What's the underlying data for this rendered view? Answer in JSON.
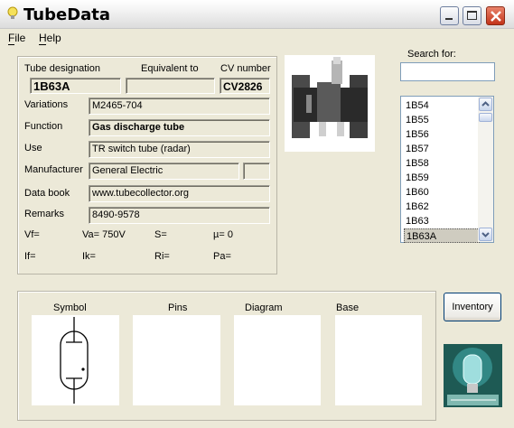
{
  "window": {
    "title": "TubeData"
  },
  "menu": {
    "file": "File",
    "help": "Help"
  },
  "header": {
    "tube_designation_label": "Tube designation",
    "tube_designation_value": "1B63A",
    "equivalent_label": "Equivalent to",
    "equivalent_value": "",
    "cv_label": "CV number",
    "cv_value": "CV2826"
  },
  "details": {
    "variations_label": "Variations",
    "variations_value": "M2465-704",
    "function_label": "Function",
    "function_value": "Gas discharge tube",
    "use_label": "Use",
    "use_value": "TR switch tube (radar)",
    "manufacturer_label": "Manufacturer",
    "manufacturer_value": "General Electric",
    "manufacturer_extra": "",
    "databook_label": "Data book",
    "databook_value": "www.tubecollector.org",
    "remarks_label": "Remarks",
    "remarks_value": "8490-9578"
  },
  "params": {
    "vf": "Vf=",
    "va": "Va=  750V",
    "s": "S=",
    "mu": "µ=    0",
    "if": "If=",
    "ik": "Ik=",
    "ri": "Ri=",
    "pa": "Pa="
  },
  "search": {
    "label": "Search for:",
    "value": ""
  },
  "tube_list": {
    "items": [
      "1B54",
      "1B55",
      "1B56",
      "1B57",
      "1B58",
      "1B59",
      "1B60",
      "1B62",
      "1B63",
      "1B63A"
    ],
    "selected": "1B63A"
  },
  "bottom": {
    "symbol": "Symbol",
    "pins": "Pins",
    "diagram": "Diagram",
    "base": "Base"
  },
  "buttons": {
    "inventory": "Inventory"
  },
  "colors": {
    "titlebar": "#f2f2f2",
    "window_bg": "#ece9d8",
    "close_btn": "#c3341a",
    "list_border": "#7f9db9"
  }
}
